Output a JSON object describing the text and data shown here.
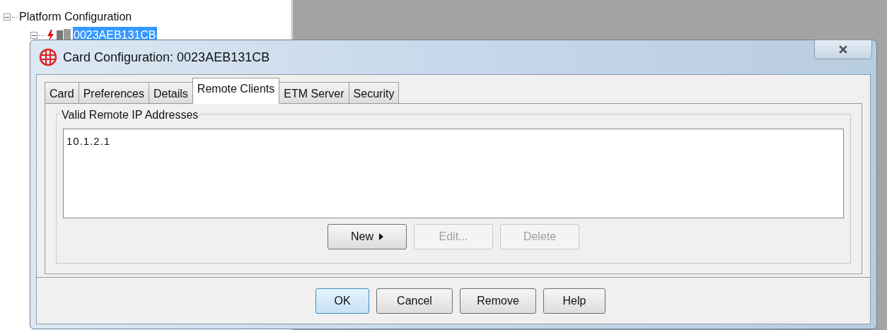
{
  "tree": {
    "label": "Platform Configuration",
    "expanded": true,
    "children": [
      {
        "label": "0023AEB131CB",
        "expanded": true,
        "selected": true
      }
    ]
  },
  "dialog": {
    "title": "Card Configuration: 0023AEB131CB",
    "tabs": [
      {
        "label": "Card",
        "selected": false
      },
      {
        "label": "Preferences",
        "selected": false
      },
      {
        "label": "Details",
        "selected": false
      },
      {
        "label": "Remote Clients",
        "selected": true
      },
      {
        "label": "ETM Server",
        "selected": false
      },
      {
        "label": "Security",
        "selected": false
      }
    ],
    "group": {
      "title": "Valid Remote IP Addresses",
      "items": [
        "10.1.2.1"
      ],
      "buttons": [
        {
          "label": "New",
          "disabled": false,
          "menu": true
        },
        {
          "label": "Edit...",
          "disabled": true,
          "menu": false
        },
        {
          "label": "Delete",
          "disabled": true,
          "menu": false
        }
      ]
    },
    "footer_buttons": [
      {
        "label": "OK",
        "default": true
      },
      {
        "label": "Cancel",
        "default": false
      },
      {
        "label": "Remove",
        "default": false
      },
      {
        "label": "Help",
        "default": false
      }
    ]
  }
}
